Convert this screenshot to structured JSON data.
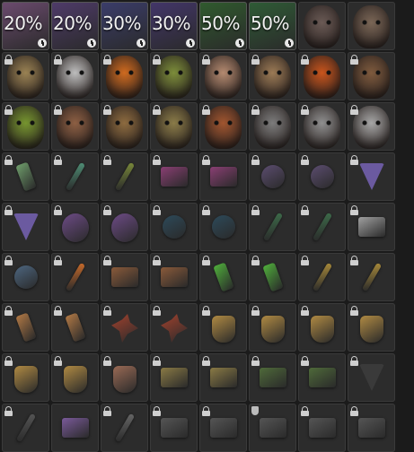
{
  "inventory": {
    "tiles": [
      {
        "kind": "bonus",
        "percent": "20%",
        "color": "#6c4b6f",
        "lock": "clock"
      },
      {
        "kind": "bonus",
        "percent": "20%",
        "color": "#4f3b6a",
        "lock": "clock"
      },
      {
        "kind": "bonus",
        "percent": "30%",
        "color": "#3b3d6b",
        "lock": "clock"
      },
      {
        "kind": "bonus",
        "percent": "30%",
        "color": "#43366a",
        "lock": "clock"
      },
      {
        "kind": "bonus",
        "percent": "50%",
        "color": "#305b2e",
        "lock": "clock"
      },
      {
        "kind": "bonus",
        "percent": "50%",
        "color": "#2f5c36",
        "lock": "clock"
      },
      {
        "kind": "face",
        "name": "purple-eyed-face",
        "color": "#6a5a55",
        "lock": "none"
      },
      {
        "kind": "face",
        "name": "bald-face",
        "color": "#7a6656",
        "lock": "none"
      },
      {
        "kind": "face",
        "name": "balaclava-face",
        "color": "#9a8253",
        "lock": "lock"
      },
      {
        "kind": "face",
        "name": "skull-face",
        "color": "#bdbdbd",
        "lock": "lock"
      },
      {
        "kind": "face",
        "name": "goggles-face",
        "color": "#cf6a1f",
        "lock": "lock"
      },
      {
        "kind": "face",
        "name": "lizard-face",
        "color": "#7c8d3a",
        "lock": "lock"
      },
      {
        "kind": "face",
        "name": "old-man-face",
        "color": "#b48a70",
        "lock": "lock"
      },
      {
        "kind": "face",
        "name": "beard-face",
        "color": "#9b7a55",
        "lock": "lock"
      },
      {
        "kind": "face",
        "name": "orange-mask-face",
        "color": "#c8541c",
        "lock": "lock"
      },
      {
        "kind": "face",
        "name": "scowl-face",
        "color": "#7e5a3d",
        "lock": "lock"
      },
      {
        "kind": "face",
        "name": "green-monster-face",
        "color": "#76952f",
        "lock": "lock"
      },
      {
        "kind": "face",
        "name": "facepaint-face",
        "color": "#8d5f43",
        "lock": "lock"
      },
      {
        "kind": "face",
        "name": "mummy-face",
        "color": "#8d6b3f",
        "lock": "lock"
      },
      {
        "kind": "face",
        "name": "zombie-face",
        "color": "#8a7b48",
        "lock": "lock"
      },
      {
        "kind": "face",
        "name": "red-face",
        "color": "#a0552f",
        "lock": "lock"
      },
      {
        "kind": "face",
        "name": "gray-mask-face",
        "color": "#7c7c7c",
        "lock": "lock"
      },
      {
        "kind": "face",
        "name": "silver-mask-face",
        "color": "#8f8f8f",
        "lock": "lock"
      },
      {
        "kind": "face",
        "name": "white-balaclava-face",
        "color": "#a6a6a6",
        "lock": "lock"
      },
      {
        "kind": "item",
        "name": "green-tag",
        "shape": "it-tag",
        "color": "#6f9d6b",
        "lock": "lock"
      },
      {
        "kind": "item",
        "name": "green-stick",
        "shape": "it-stick",
        "color": "#4f8f76",
        "lock": "lock"
      },
      {
        "kind": "item",
        "name": "traffic-light-charm",
        "shape": "it-stick",
        "color": "#7a8a3a",
        "lock": "lock"
      },
      {
        "kind": "item",
        "name": "purple-tray",
        "shape": "it-box",
        "color": "#8a3f73",
        "lock": "lock"
      },
      {
        "kind": "item",
        "name": "purple-tray-2",
        "shape": "it-box",
        "color": "#8a3f73",
        "lock": "lock"
      },
      {
        "kind": "item",
        "name": "purple-star-badge",
        "shape": "it-star",
        "color": "#5c4d70",
        "lock": "lock"
      },
      {
        "kind": "item",
        "name": "purple-star-badge-2",
        "shape": "it-star",
        "color": "#5c4d70",
        "lock": "lock"
      },
      {
        "kind": "item",
        "name": "purple-triangle",
        "shape": "it-tri",
        "color": "#6b5aa0",
        "lock": "lock"
      },
      {
        "kind": "item",
        "name": "purple-triangle-2",
        "shape": "it-tri",
        "color": "#6b5aa0",
        "lock": "lock"
      },
      {
        "kind": "item",
        "name": "purple-disc",
        "shape": "it-rings",
        "color": "#6d4b86",
        "lock": "lock"
      },
      {
        "kind": "item",
        "name": "purple-disc-2",
        "shape": "it-rings",
        "color": "#6d4b86",
        "lock": "lock"
      },
      {
        "kind": "item",
        "name": "snowflake-charm",
        "shape": "it-star",
        "color": "#2d4a5a",
        "lock": "lock"
      },
      {
        "kind": "item",
        "name": "snowflake-charm-2",
        "shape": "it-star",
        "color": "#2d4a5a",
        "lock": "lock"
      },
      {
        "kind": "item",
        "name": "red-green-charm",
        "shape": "it-stick",
        "color": "#3d6b4a",
        "lock": "lock"
      },
      {
        "kind": "item",
        "name": "red-green-charm-2",
        "shape": "it-stick",
        "color": "#3d6b4a",
        "lock": "lock"
      },
      {
        "kind": "item",
        "name": "robot-charm",
        "shape": "it-box",
        "color": "#a0a0a0",
        "lock": "lock"
      },
      {
        "kind": "item",
        "name": "blue-gear",
        "shape": "it-star",
        "color": "#4d6680",
        "lock": "lock"
      },
      {
        "kind": "item",
        "name": "carrot-charm",
        "shape": "it-stick",
        "color": "#c86a2a",
        "lock": "lock"
      },
      {
        "kind": "item",
        "name": "wood-panel",
        "shape": "it-box",
        "color": "#8a5a3a",
        "lock": "lock"
      },
      {
        "kind": "item",
        "name": "wood-panel-2",
        "shape": "it-box",
        "color": "#8a5a3a",
        "lock": "lock"
      },
      {
        "kind": "item",
        "name": "green-pendant",
        "shape": "it-tag",
        "color": "#4fae3b",
        "lock": "lock"
      },
      {
        "kind": "item",
        "name": "green-pendant-2",
        "shape": "it-tag",
        "color": "#4fae3b",
        "lock": "lock"
      },
      {
        "kind": "item",
        "name": "yellow-stick",
        "shape": "it-stick",
        "color": "#a88a3a",
        "lock": "lock"
      },
      {
        "kind": "item",
        "name": "yellow-stick-2",
        "shape": "it-stick",
        "color": "#a88a3a",
        "lock": "lock"
      },
      {
        "kind": "item",
        "name": "orange-tag",
        "shape": "it-tag",
        "color": "#b07845",
        "lock": "lock"
      },
      {
        "kind": "item",
        "name": "orange-tag-2",
        "shape": "it-tag",
        "color": "#b07845",
        "lock": "lock"
      },
      {
        "kind": "item",
        "name": "red-bird",
        "shape": "it-bird",
        "color": "#a3422e",
        "lock": "lock"
      },
      {
        "kind": "item",
        "name": "red-bird-2",
        "shape": "it-bird",
        "color": "#a3422e",
        "lock": "lock"
      },
      {
        "kind": "item",
        "name": "gold-dogtag",
        "shape": "it-dog",
        "color": "#b08a43",
        "lock": "lock"
      },
      {
        "kind": "item",
        "name": "gold-dogtag-2",
        "shape": "it-dog",
        "color": "#b08a43",
        "lock": "lock"
      },
      {
        "kind": "item",
        "name": "gold-dogtag-3",
        "shape": "it-dog",
        "color": "#b08a43",
        "lock": "lock"
      },
      {
        "kind": "item",
        "name": "gold-dogtag-4",
        "shape": "it-dog",
        "color": "#b08a43",
        "lock": "lock"
      },
      {
        "kind": "item",
        "name": "gold-dogtag-5",
        "shape": "it-dog",
        "color": "#b08a43",
        "lock": "lock"
      },
      {
        "kind": "item",
        "name": "gold-dogtag-6",
        "shape": "it-dog",
        "color": "#b08a43",
        "lock": "lock"
      },
      {
        "kind": "item",
        "name": "brown-tag",
        "shape": "it-dog",
        "color": "#9a6a55",
        "lock": "lock"
      },
      {
        "kind": "item",
        "name": "gold-square-tag",
        "shape": "it-box",
        "color": "#8a7a45",
        "lock": "lock"
      },
      {
        "kind": "item",
        "name": "gold-square-tag-2",
        "shape": "it-box",
        "color": "#8a7a45",
        "lock": "lock"
      },
      {
        "kind": "item",
        "name": "green-camo-box",
        "shape": "it-box",
        "color": "#4f6a3a",
        "lock": "lock"
      },
      {
        "kind": "item",
        "name": "green-camo-box-2",
        "shape": "it-box",
        "color": "#4f6a3a",
        "lock": "lock"
      },
      {
        "kind": "item",
        "name": "triangle-string",
        "shape": "it-tri",
        "color": "#3a3a3a",
        "lock": "lock"
      },
      {
        "kind": "item",
        "name": "partial-1",
        "shape": "it-stick",
        "color": "#555",
        "lock": "lock"
      },
      {
        "kind": "item",
        "name": "partial-2",
        "shape": "it-box",
        "color": "#7a5a9a",
        "lock": "none"
      },
      {
        "kind": "item",
        "name": "partial-3",
        "shape": "it-stick",
        "color": "#666",
        "lock": "lock"
      },
      {
        "kind": "item",
        "name": "partial-4",
        "shape": "it-box",
        "color": "#555",
        "lock": "lock"
      },
      {
        "kind": "item",
        "name": "partial-5",
        "shape": "it-box",
        "color": "#555",
        "lock": "lock"
      },
      {
        "kind": "item",
        "name": "partial-6",
        "shape": "it-box",
        "color": "#555",
        "lock": "shield"
      },
      {
        "kind": "item",
        "name": "partial-7",
        "shape": "it-box",
        "color": "#555",
        "lock": "lock"
      },
      {
        "kind": "item",
        "name": "partial-8",
        "shape": "it-box",
        "color": "#555",
        "lock": "lock"
      }
    ]
  }
}
